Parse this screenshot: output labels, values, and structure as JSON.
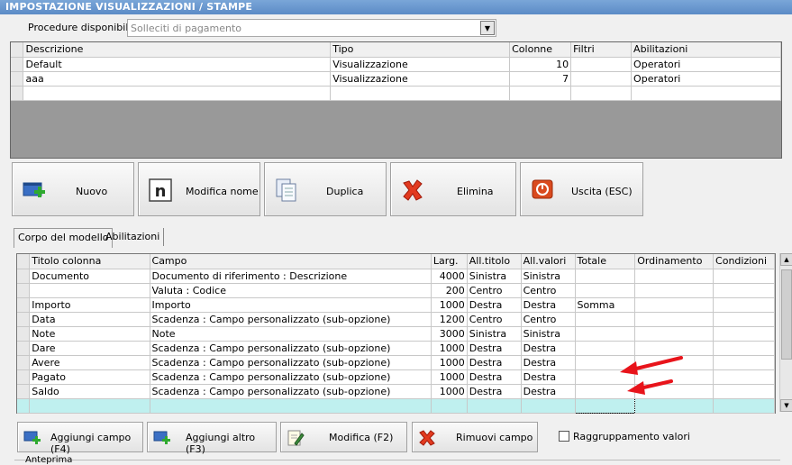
{
  "window": {
    "title": "IMPOSTAZIONE VISUALIZZAZIONI / STAMPE"
  },
  "procedure": {
    "label": "Procedure disponibili :",
    "value": "Solleciti di pagamento"
  },
  "top_table": {
    "headers": [
      "Descrizione",
      "Tipo",
      "Colonne",
      "Filtri",
      "Abilitazioni"
    ],
    "rows": [
      [
        "Default",
        "Visualizzazione",
        "10",
        "",
        "Operatori"
      ],
      [
        "aaa",
        "Visualizzazione",
        "7",
        "",
        "Operatori"
      ]
    ]
  },
  "toolbar": {
    "nuovo": "Nuovo",
    "modifica_nome": "Modifica nome",
    "duplica": "Duplica",
    "elimina": "Elimina",
    "uscita": "Uscita (ESC)"
  },
  "tabs": [
    "Corpo del modello",
    "Abilitazioni"
  ],
  "bottom_table": {
    "headers": [
      "Titolo colonna",
      "Campo",
      "Larg.",
      "All.titolo",
      "All.valori",
      "Totale",
      "Ordinamento",
      "Condizioni"
    ],
    "rows": [
      [
        "Documento",
        "Documento di riferimento : Descrizione",
        "4000",
        "Sinistra",
        "Sinistra",
        "",
        "",
        ""
      ],
      [
        "",
        "Valuta : Codice",
        "200",
        "Centro",
        "Centro",
        "",
        "",
        ""
      ],
      [
        "Importo",
        "Importo",
        "1000",
        "Destra",
        "Destra",
        "Somma",
        "",
        ""
      ],
      [
        "Data",
        "Scadenza : Campo personalizzato (sub-opzione)",
        "1200",
        "Centro",
        "Centro",
        "",
        "",
        ""
      ],
      [
        "Note",
        "Note",
        "3000",
        "Sinistra",
        "Sinistra",
        "",
        "",
        ""
      ],
      [
        "Dare",
        "Scadenza : Campo personalizzato (sub-opzione)",
        "1000",
        "Destra",
        "Destra",
        "",
        "",
        ""
      ],
      [
        "Avere",
        "Scadenza : Campo personalizzato (sub-opzione)",
        "1000",
        "Destra",
        "Destra",
        "",
        "",
        ""
      ],
      [
        "Pagato",
        "Scadenza : Campo personalizzato (sub-opzione)",
        "1000",
        "Destra",
        "Destra",
        "",
        "",
        ""
      ],
      [
        "Saldo",
        "Scadenza : Campo personalizzato (sub-opzione)",
        "1000",
        "Destra",
        "Destra",
        "",
        "",
        ""
      ]
    ]
  },
  "bottom_buttons": {
    "aggiungi_campo": "Aggiungi campo (F4)",
    "aggiungi_altro": "Aggiungi altro (F3)",
    "modifica": "Modifica (F2)",
    "rimuovi": "Rimuovi campo"
  },
  "options": {
    "raggruppamento": "Raggruppamento valori"
  },
  "preview": {
    "label": "Anteprima"
  },
  "colors": {
    "arrow": "#e8141b",
    "title_bar": "#6a97cf",
    "new_row": "#bff0ef"
  }
}
